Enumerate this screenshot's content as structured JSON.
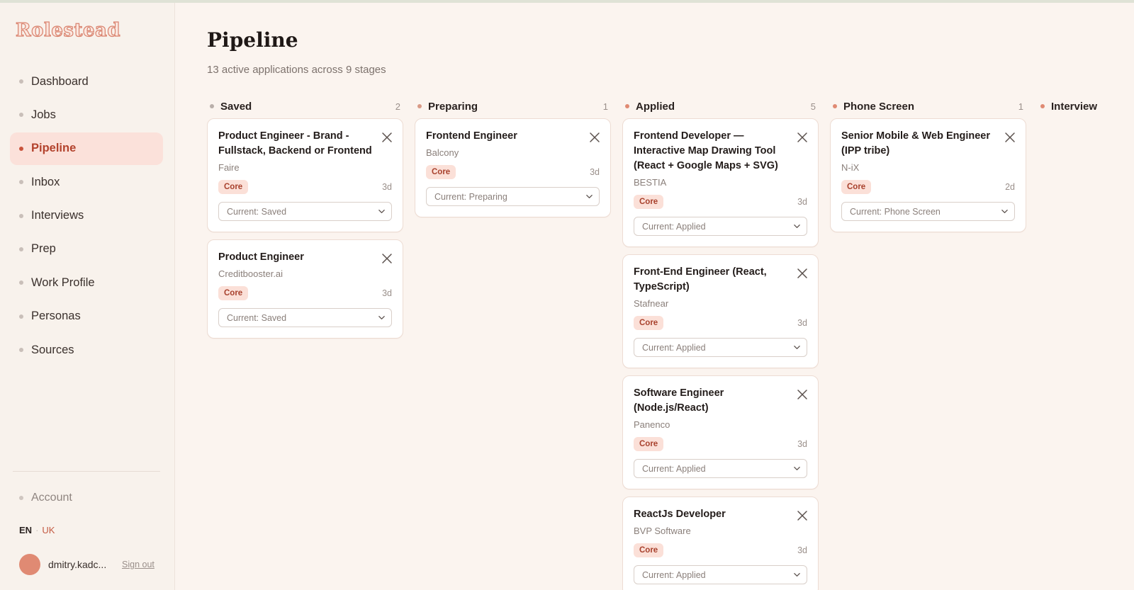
{
  "brand": {
    "name": "Rolestead"
  },
  "colors": {
    "accent": "#c9533b",
    "badge_bg": "#fbe0d8",
    "badge_text": "#a8412d",
    "background": "#fbf4ef"
  },
  "nav": {
    "items": [
      {
        "label": "Dashboard",
        "active": false
      },
      {
        "label": "Jobs",
        "active": false
      },
      {
        "label": "Pipeline",
        "active": true
      },
      {
        "label": "Inbox",
        "active": false
      },
      {
        "label": "Interviews",
        "active": false
      },
      {
        "label": "Prep",
        "active": false
      },
      {
        "label": "Work Profile",
        "active": false
      },
      {
        "label": "Personas",
        "active": false
      },
      {
        "label": "Sources",
        "active": false
      }
    ],
    "account_label": "Account"
  },
  "lang": {
    "en": "EN",
    "separator": "·",
    "uk": "UK"
  },
  "user": {
    "name": "dmitry.kadc...",
    "signout": "Sign out"
  },
  "page": {
    "title": "Pipeline",
    "subtitle": "13 active applications across 9 stages"
  },
  "columns": [
    {
      "title": "Saved",
      "count": "2",
      "dot_color": "#b9afaa",
      "cards": [
        {
          "title": "Product Engineer - Brand - Fullstack, Backend or Frontend",
          "company": "Faire",
          "badge": "Core",
          "age": "3d",
          "status": "Current: Saved"
        },
        {
          "title": "Product Engineer",
          "company": "Creditbooster.ai",
          "badge": "Core",
          "age": "3d",
          "status": "Current: Saved"
        }
      ]
    },
    {
      "title": "Preparing",
      "count": "1",
      "dot_color": "#d99a86",
      "cards": [
        {
          "title": "Frontend Engineer",
          "company": "Balcony",
          "badge": "Core",
          "age": "3d",
          "status": "Current: Preparing"
        }
      ]
    },
    {
      "title": "Applied",
      "count": "5",
      "dot_color": "#e08a73",
      "cards": [
        {
          "title": "Frontend Developer — Interactive Map Drawing Tool (React + Google Maps + SVG)",
          "company": "BESTIA",
          "badge": "Core",
          "age": "3d",
          "status": "Current: Applied"
        },
        {
          "title": "Front-End Engineer (React, TypeScript)",
          "company": "Stafnear",
          "badge": "Core",
          "age": "3d",
          "status": "Current: Applied"
        },
        {
          "title": "Software Engineer (Node.js/React)",
          "company": "Panenco",
          "badge": "Core",
          "age": "3d",
          "status": "Current: Applied"
        },
        {
          "title": "ReactJs Developer",
          "company": "BVP Software",
          "badge": "Core",
          "age": "3d",
          "status": "Current: Applied"
        }
      ]
    },
    {
      "title": "Phone Screen",
      "count": "1",
      "dot_color": "#e08a73",
      "cards": [
        {
          "title": "Senior Mobile & Web Engineer (IPP tribe)",
          "company": "N-iX",
          "badge": "Core",
          "age": "2d",
          "status": "Current: Phone Screen"
        }
      ]
    },
    {
      "title": "Interview",
      "count": "",
      "dot_color": "#e08a73",
      "cards": []
    }
  ]
}
